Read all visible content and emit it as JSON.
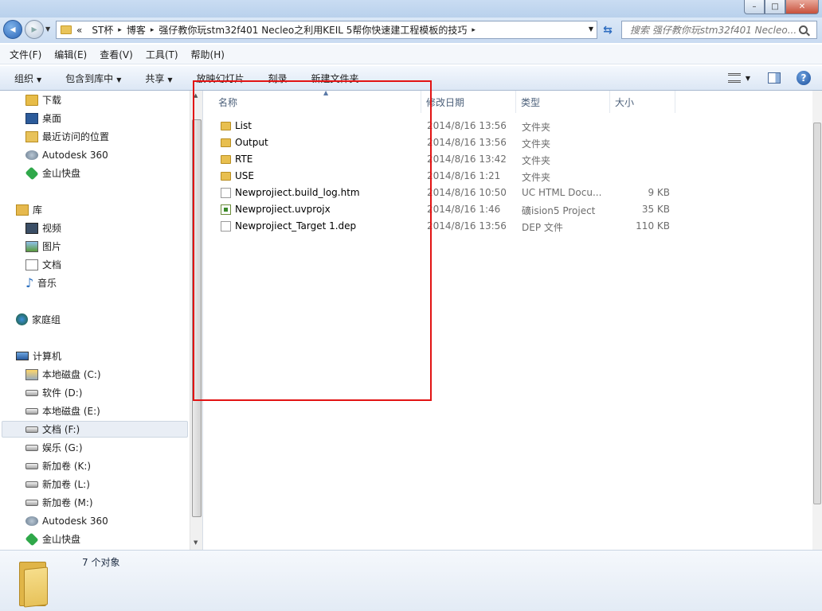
{
  "window": {
    "title": "",
    "minimize_glyph": "–",
    "maximize_glyph": "□",
    "close_glyph": "✕"
  },
  "address": {
    "crumbs": [
      "ST杯",
      "博客",
      "强仔教你玩stm32f401 Necleo之利用KEIL 5帮你快速建工程模板的技巧"
    ],
    "prefix": "«",
    "separator": "▸",
    "search_placeholder": "搜索 强仔教你玩stm32f401 Necleo..."
  },
  "menu": {
    "items": [
      "文件(F)",
      "编辑(E)",
      "查看(V)",
      "工具(T)",
      "帮助(H)"
    ]
  },
  "toolbar": {
    "organize": "组织",
    "include_library": "包含到库中",
    "share": "共享",
    "slideshow": "放映幻灯片",
    "burn": "刻录",
    "new_folder": "新建文件夹",
    "help_glyph": "?"
  },
  "nav": {
    "favorites": [
      "下载",
      "桌面",
      "最近访问的位置",
      "Autodesk 360",
      "金山快盘"
    ],
    "library_header": "库",
    "libraries": [
      "视频",
      "图片",
      "文档",
      "音乐"
    ],
    "homegroup": "家庭组",
    "computer_header": "计算机",
    "drives": [
      "本地磁盘 (C:)",
      "软件 (D:)",
      "本地磁盘 (E:)",
      "文档 (F:)",
      "娱乐 (G:)",
      "新加卷 (K:)",
      "新加卷 (L:)",
      "新加卷 (M:)",
      "Autodesk 360",
      "金山快盘"
    ],
    "selected_drive": "文档 (F:)"
  },
  "columns": {
    "name": "名称",
    "modified": "修改日期",
    "type": "类型",
    "size": "大小"
  },
  "files": [
    {
      "name": "List",
      "date": "2014/8/16 13:56",
      "type": "文件夹",
      "size": "",
      "icon": "folder-icon"
    },
    {
      "name": "Output",
      "date": "2014/8/16 13:56",
      "type": "文件夹",
      "size": "",
      "icon": "folder-icon"
    },
    {
      "name": "RTE",
      "date": "2014/8/16 13:42",
      "type": "文件夹",
      "size": "",
      "icon": "folder-icon"
    },
    {
      "name": "USE",
      "date": "2014/8/16 1:21",
      "type": "文件夹",
      "size": "",
      "icon": "folder-icon"
    },
    {
      "name": "Newprojiect.build_log.htm",
      "date": "2014/8/16 10:50",
      "type": "UC HTML Docu...",
      "size": "9 KB",
      "icon": "html-file-icon"
    },
    {
      "name": "Newprojiect.uvprojx",
      "date": "2014/8/16 1:46",
      "type": "礦ision5 Project",
      "size": "35 KB",
      "icon": "uvision-project-icon"
    },
    {
      "name": "Newprojiect_Target 1.dep",
      "date": "2014/8/16 13:56",
      "type": "DEP 文件",
      "size": "110 KB",
      "icon": "dep-file-icon"
    }
  ],
  "status": {
    "count": "7 个对象"
  },
  "colors": {
    "highlight_box": "#e21313",
    "toolbar_bg": "#dce7f5"
  }
}
